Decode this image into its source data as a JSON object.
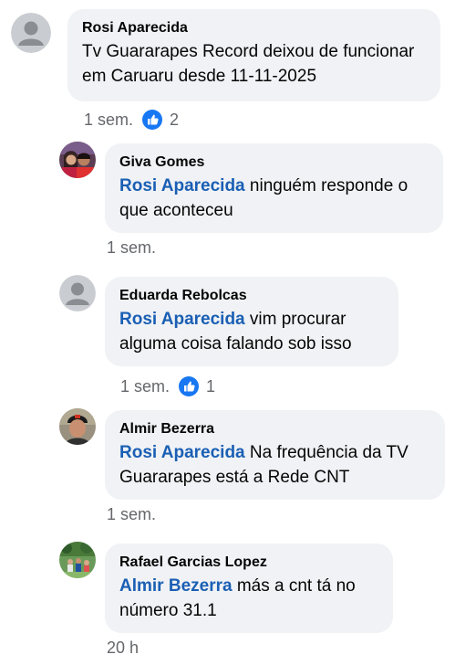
{
  "comments": [
    {
      "author": "Rosi Aparecida",
      "mention": "",
      "text": "Tv Guararapes Record deixou de funcionar em Caruaru desde 11-11-2025",
      "time": "1 sem.",
      "reactions": "2",
      "avatar": "default-avatar-icon"
    },
    {
      "author": "Giva Gomes",
      "mention": "Rosi Aparecida",
      "text": "ninguém responde o que aconteceu",
      "time": "1 sem.",
      "reactions": "",
      "avatar": "couple-photo-avatar"
    },
    {
      "author": "Eduarda Rebolcas",
      "mention": "Rosi Aparecida",
      "text": "vim procurar alguma coisa falando sob isso",
      "time": "1 sem.",
      "reactions": "1",
      "avatar": "default-avatar-icon"
    },
    {
      "author": "Almir Bezerra",
      "mention": "Rosi Aparecida",
      "text": "Na frequência da TV Guararapes está a Rede CNT",
      "time": "1 sem.",
      "reactions": "",
      "avatar": "man-cap-photo-avatar"
    },
    {
      "author": "Rafael Garcias Lopez",
      "mention": "Almir Bezerra",
      "text": "más a cnt tá no número 31.1",
      "time": "20 h",
      "reactions": "",
      "avatar": "group-outdoor-photo-avatar"
    }
  ],
  "colors": {
    "bubble": "#f0f2f5",
    "mention": "#1a5fb4",
    "meta": "#65676b",
    "like": "#1877f2"
  }
}
